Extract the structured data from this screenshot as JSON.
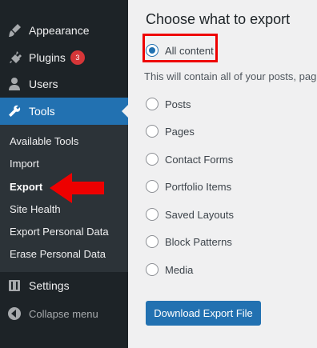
{
  "sidebar": {
    "items": [
      {
        "label": "Appearance",
        "icon": "paintbrush-icon"
      },
      {
        "label": "Plugins",
        "icon": "plugin-icon",
        "badge": "3"
      },
      {
        "label": "Users",
        "icon": "users-icon"
      },
      {
        "label": "Tools",
        "icon": "wrench-icon",
        "active": true
      },
      {
        "label": "Settings",
        "icon": "settings-icon"
      },
      {
        "label": "Collapse menu",
        "icon": "collapse-icon"
      }
    ],
    "submenu": [
      {
        "label": "Available Tools"
      },
      {
        "label": "Import"
      },
      {
        "label": "Export",
        "current": true
      },
      {
        "label": "Site Health"
      },
      {
        "label": "Export Personal Data"
      },
      {
        "label": "Erase Personal Data"
      }
    ]
  },
  "main": {
    "heading": "Choose what to export",
    "description": "This will contain all of your posts, pag",
    "options": [
      {
        "label": "All content",
        "checked": true
      },
      {
        "label": "Posts"
      },
      {
        "label": "Pages"
      },
      {
        "label": "Contact Forms"
      },
      {
        "label": "Portfolio Items"
      },
      {
        "label": "Saved Layouts"
      },
      {
        "label": "Block Patterns"
      },
      {
        "label": "Media"
      }
    ],
    "download_button": "Download Export File"
  },
  "colors": {
    "sidebar_bg": "#1d2327",
    "submenu_bg": "#2c3338",
    "accent": "#2271b1",
    "badge": "#d63638",
    "annotation": "#ee0000"
  }
}
